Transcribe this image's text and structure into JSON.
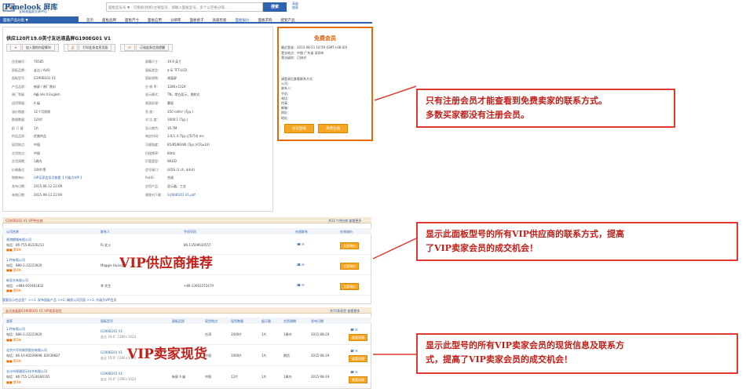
{
  "header": {
    "logo_name": "Panelook 屏库",
    "logo_sub": "全球液晶屏交易中心",
    "search_placeholder": "面板型号号  ▼   ·   可搜索(例如)主要型号，请输入面板型号，多个以空格分隔...",
    "search_label": "搜索",
    "adv_links": [
      "高级",
      "搜索"
    ]
  },
  "nav": {
    "category": "面板产品分类 ▼",
    "items": [
      "首页",
      "面板品牌",
      "面板尺寸",
      "面板应用",
      "分辨率",
      "面板接子",
      "高级检索",
      "面板报价",
      "面板求购",
      "配套产品"
    ]
  },
  "product": {
    "title": "供应120片19.0英寸友达液晶屏G190EG01 V1",
    "buttons": [
      "加入我的内容模块",
      "打印此条信息页面",
      "订阅此条信息提醒"
    ],
    "specs_left": [
      [
        "信息编号：",
        "70585"
      ],
      [
        "面板品牌：",
        "友达 / AUO"
      ],
      [
        "面板型号：",
        "G190EG01 V1"
      ],
      [
        "产品品质：",
        "新屏 / 原厂原封"
      ],
      [
        "原厂等级：",
        "A级 Ver.0 English"
      ],
      [
        "适用等级：",
        "A 级"
      ],
      [
        "该价格度：",
        "12个月质保"
      ],
      [
        "数量数量：",
        "120片"
      ],
      [
        "起 订 量：",
        "1片"
      ],
      [
        "供品品质：",
        "优普供品"
      ],
      [
        "现货地点：",
        "中国"
      ],
      [
        "交货地点：",
        "中国"
      ],
      [
        "交货周期：",
        "1周内"
      ],
      [
        "价格备注：",
        "100片等"
      ],
      [
        "销售单价：",
        "VIP买家会员可查看【 升级为VIP 】"
      ],
      [
        "发布日期：",
        "2015-06-12 22:09"
      ],
      [
        "有效日期：",
        "2015-09-12 22:09"
      ]
    ],
    "specs_right": [
      [
        "屏幕尺寸：",
        "19.0 英寸"
      ],
      [
        "面板类型：",
        "a-Si TFT-LCD"
      ],
      [
        "面板规格：",
        "液晶屏"
      ],
      [
        "分 辨 率：",
        "1280×1024"
      ],
      [
        "显示模式：",
        "TN，常白显示，透射式"
      ],
      [
        "表面处理：",
        "雾面"
      ],
      [
        "亮 度：",
        "350 cd/m² (Typ.)"
      ],
      [
        "对 比 度：",
        "1000:1 (Typ.)"
      ],
      [
        "显示颜色：",
        "16.7M"
      ],
      [
        "响应时间：",
        "3.6/1.4 (Typ.)(Tr/Td) ms"
      ],
      [
        "可视角度：",
        "85/85/80/80 (Typ.)(CR≥10)"
      ],
      [
        "扫描频率：",
        "60Hz"
      ],
      [
        "灯管类型：",
        "WLED"
      ],
      [
        "信号接口：",
        "LVDS (2 ch, 8-bit)"
      ],
      [
        "RoHS：",
        "合规"
      ],
      [
        "应用产品：",
        "显示器，工业"
      ],
      [
        "规格书下载：",
        "G190EG01 V1.pdf"
      ]
    ]
  },
  "free_member": {
    "title": "免费会员",
    "lines": [
      "最近登录：2015-08-21 10:59 (GMT+08:00)",
      "营业地点：中国 广东省 深圳市",
      "营业级别：已核对"
    ],
    "contact_lines": [
      "请登录后查看联系方式：",
      "公司：",
      "联系人：",
      "手机：",
      "电话：",
      "传真：",
      "邮箱：",
      "网址：",
      "地址："
    ],
    "btn_login": "会员登录",
    "btn_register": "免费注册"
  },
  "vip_suppliers": {
    "head": "G190EG01 V1 VIP供应商",
    "more": "共31个供应商 查看更多",
    "columns": [
      "公司名称",
      "联系人",
      "手机号码",
      "在线联系",
      "在线询价"
    ],
    "rows": [
      {
        "company": "香港麒城有限公司",
        "phone": "电话：86-755-83226213",
        "contact": "Ri 女士",
        "mobile": "86-13509630557",
        "btn": "立即询价"
      },
      {
        "company": "1.特有限公司",
        "phone": "电话：886-2-22223920",
        "contact": "Maggie Huang",
        "mobile": "",
        "btn": "立即询价"
      },
      {
        "company": "新亚光有限公司",
        "phone": "电话：+886-920461832",
        "contact": "李 先生",
        "mobile": "+86-13602272479",
        "btn": "立即询价"
      }
    ],
    "hint": "我要显示在这里？ >>1. 发布面板产品  >>2. 确保公司页面  >>3. 升级为VIP会员"
  },
  "stock": {
    "head": "友达液晶屏G190EG01 V1 VIP卖家现货",
    "more": "共15条现货 查看更多",
    "columns": [
      "卖家",
      "面板型号",
      "面板品质",
      "现货地点",
      "现货数量",
      "起订量",
      "交货周期",
      "发布日期"
    ],
    "rows": [
      {
        "seller": "1.特有限公司",
        "phone": "电话：886-2-22223920",
        "model": "G190EG01 V1",
        "desc": "友达 19.0\" 1280×1024",
        "grade": "",
        "place": "台湾",
        "qty": "1000片",
        "moq": "1片",
        "lead": "1周内",
        "date": "2015-08-20",
        "btn": "查看详情"
      },
      {
        "seller": "北京兴华利商贸股份有限公司",
        "phone": "电话：86-10-82039698, 82039687",
        "model": "G190EG01 V1",
        "desc": "友达 19.0\" 1280×1024",
        "grade": "",
        "place": "中国",
        "qty": "1000片",
        "moq": "1片",
        "lead": "期货",
        "date": "2015-08-19",
        "btn": "查看详情"
      },
      {
        "seller": "长沙市视通显示技术有限公司",
        "phone": "电话：86-755-13530184165",
        "model": "G190EG01 V1",
        "desc": "友达 19.0\" 1280×1024",
        "grade": "新屏 A 级",
        "place": "中国",
        "qty": "12片",
        "moq": "1片",
        "lead": "1周内",
        "date": "2015-08-19",
        "btn": "查看详情"
      }
    ]
  },
  "overlays": {
    "vip_supplier_label": "VIP供应商推荐",
    "vip_stock_label": "VIP卖家现货",
    "callout1": [
      "只有注册会员才能查看到免费卖家的联系方式。",
      "多数买家都没有注册会员。"
    ],
    "callout2": [
      "显示此面板型号的所有VIP供应商的联系方式，提高",
      "了VIP卖家会员的成交机会！"
    ],
    "callout3": [
      "显示此型号的所有VIP卖家会员的现货信息及联系方",
      "式，提高了VIP卖家会员的成交机会！"
    ]
  },
  "colors": {
    "accent": "#2f63ad",
    "highlight": "#e56a00",
    "callout": "#e03a30"
  }
}
